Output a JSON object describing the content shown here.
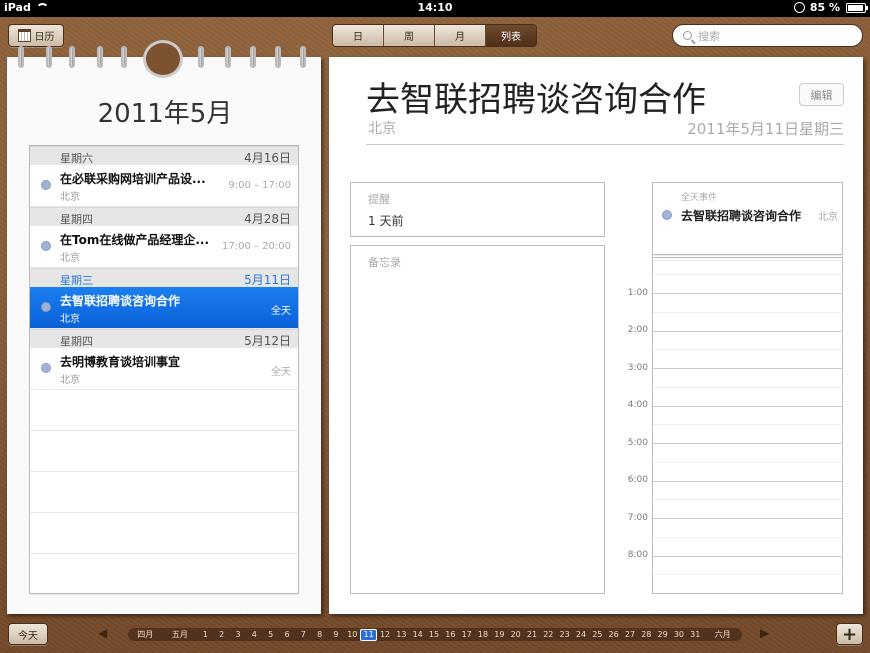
{
  "status": {
    "device": "iPad",
    "time": "14:10",
    "battery": "85 %"
  },
  "toolbar": {
    "calendars": "日历",
    "views": [
      "日",
      "周",
      "月",
      "列表"
    ],
    "selected_view": "列表",
    "search_placeholder": "搜索"
  },
  "list": {
    "month_title": "2011年5月",
    "groups": [
      {
        "weekday": "星期六",
        "date": "4月16日",
        "highlight": false,
        "events": [
          {
            "title": "在必联采购网培训产品设...",
            "location": "北京",
            "time": "9:00 – 17:00",
            "selected": false
          }
        ]
      },
      {
        "weekday": "星期四",
        "date": "4月28日",
        "highlight": false,
        "events": [
          {
            "title": "在Tom在线做产品经理企...",
            "location": "北京",
            "time": "17:00 – 20:00",
            "selected": false
          }
        ]
      },
      {
        "weekday": "星期三",
        "date": "5月11日",
        "highlight": true,
        "events": [
          {
            "title": "去智联招聘谈咨询合作",
            "location": "北京",
            "time": "全天",
            "selected": true
          }
        ]
      },
      {
        "weekday": "星期四",
        "date": "5月12日",
        "highlight": false,
        "events": [
          {
            "title": "去明博教育谈培训事宜",
            "location": "北京",
            "time": "全天",
            "selected": false
          }
        ]
      }
    ]
  },
  "detail": {
    "title": "去智联招聘谈咨询合作",
    "edit_label": "编辑",
    "location": "北京",
    "date": "2011年5月11日星期三",
    "reminder_label": "提醒",
    "reminder_value": "1 天前",
    "notes_label": "备忘录"
  },
  "day": {
    "allday_label": "全天事件",
    "event_title": "去智联招聘谈咨询合作",
    "event_location": "北京",
    "hours": [
      "1:00",
      "2:00",
      "3:00",
      "4:00",
      "5:00",
      "6:00",
      "7:00",
      "8:00"
    ]
  },
  "bottom": {
    "today_label": "今天",
    "add_label": "+",
    "prev_month": "四月",
    "month": "五月",
    "next_month": "六月",
    "days": [
      "1",
      "2",
      "3",
      "4",
      "5",
      "6",
      "7",
      "8",
      "9",
      "10",
      "11",
      "12",
      "13",
      "14",
      "15",
      "16",
      "17",
      "18",
      "19",
      "20",
      "21",
      "22",
      "23",
      "24",
      "25",
      "26",
      "27",
      "28",
      "29",
      "30",
      "31"
    ],
    "current_day": "11"
  },
  "colors": {
    "selected": "#1b7ff0",
    "highlight_text": "#2b7ad6",
    "wood": "#7a5232"
  }
}
